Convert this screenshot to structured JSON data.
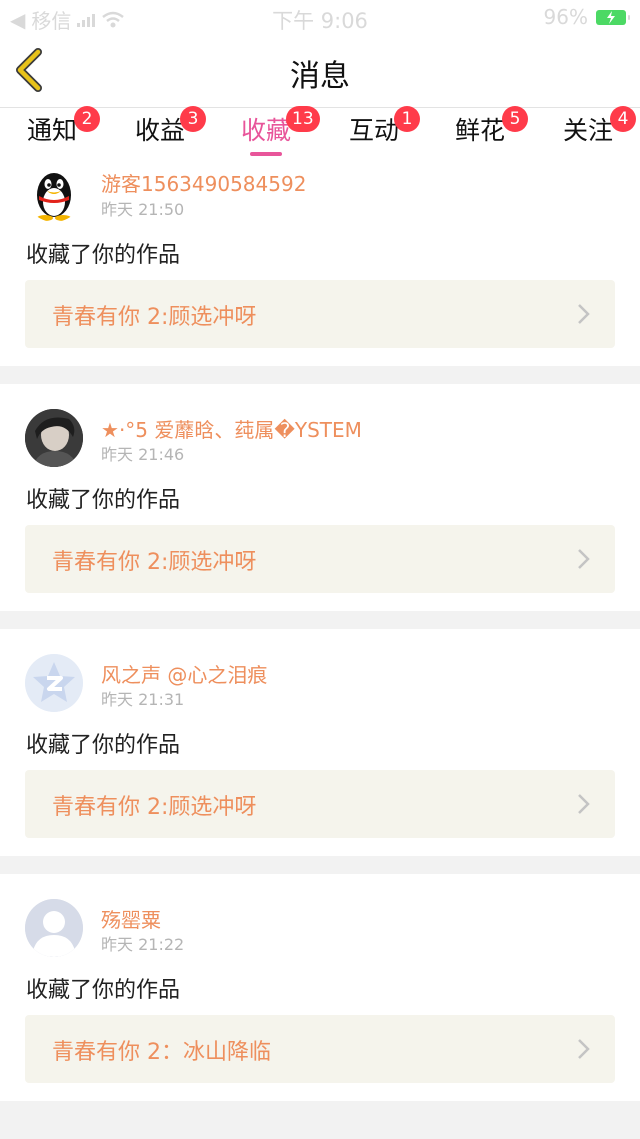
{
  "status_bar": {
    "carrier": "移信",
    "time": "下午 9:06",
    "battery": "96%"
  },
  "header": {
    "title": "消息"
  },
  "tabs": [
    {
      "label": "通知",
      "badge": "2",
      "active": false
    },
    {
      "label": "收益",
      "badge": "3",
      "active": false
    },
    {
      "label": "收藏",
      "badge": "13",
      "active": true
    },
    {
      "label": "互动",
      "badge": "1",
      "active": false
    },
    {
      "label": "鲜花",
      "badge": "5",
      "active": false
    },
    {
      "label": "关注",
      "badge": "4",
      "active": false
    }
  ],
  "feed": [
    {
      "user": "游客1563490584592",
      "time": "昨天 21:50",
      "message": "收藏了你的作品",
      "work": "青春有你 2:顾选冲呀",
      "avatar": "qq-penguin-avatar"
    },
    {
      "user": "·°5 爱蘼晗、莼属�YSTEM",
      "time": "昨天 21:46",
      "message": "收藏了你的作品",
      "work": "青春有你 2:顾选冲呀",
      "avatar": "photo-avatar"
    },
    {
      "user": "风之声 @心之泪痕",
      "time": "昨天 21:31",
      "message": "收藏了你的作品",
      "work": "青春有你 2:顾选冲呀",
      "avatar": "qzone-avatar"
    },
    {
      "user": "殇罂粟",
      "time": "昨天 21:22",
      "message": "收藏了你的作品",
      "work": "青春有你 2：冰山降临",
      "avatar": "default-avatar"
    }
  ],
  "colors": {
    "accent": "#e8559a",
    "username": "#ee8f5d",
    "badge": "#ff3b4a",
    "back_arrow": "#e7c21a",
    "work_card_bg": "#f5f4ec"
  }
}
